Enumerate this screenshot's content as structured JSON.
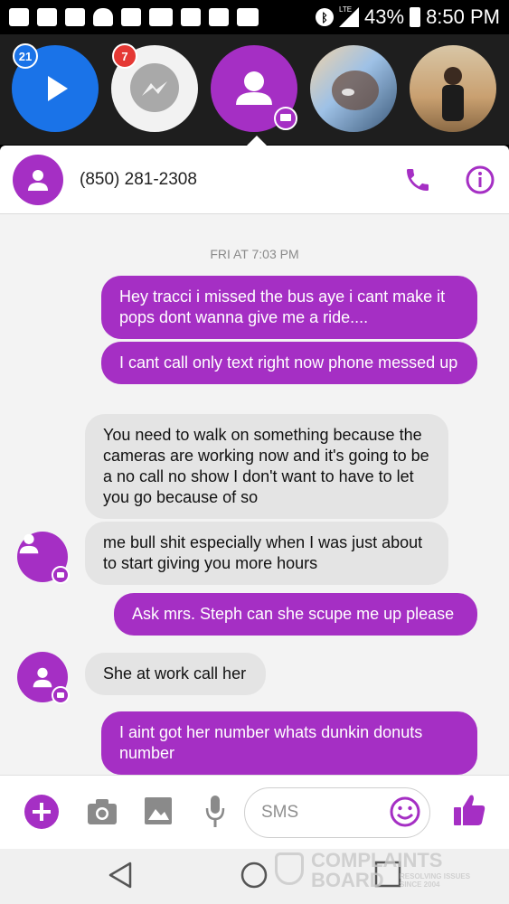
{
  "status_bar": {
    "battery": "43%",
    "time": "8:50 PM",
    "network": "LTE",
    "icons": [
      "notification-icon",
      "facebook-icon",
      "mail-icon",
      "bell-icon",
      "instagram-icon",
      "youtube-icon",
      "gallery-icon",
      "facebook-icon",
      "muted-icon",
      "bluetooth-icon",
      "signal-icon",
      "battery-icon"
    ]
  },
  "chat_heads": [
    {
      "icon": "play-icon",
      "badge": "21",
      "color": "#1a73e8",
      "badge_color": "#1a73e8"
    },
    {
      "icon": "messenger-icon",
      "badge": "7",
      "color": "#f5f5f5",
      "badge_color": "#e53935"
    },
    {
      "icon": "person-icon",
      "active": true,
      "color": "#a52fc4"
    },
    {
      "icon": "contact-photo-1"
    },
    {
      "icon": "contact-photo-2"
    }
  ],
  "contact": {
    "number": "(850) 281-2308",
    "call_icon": "phone-icon",
    "info_icon": "info-icon"
  },
  "conversation": {
    "timestamp": "FRI AT 7:03 PM",
    "messages": [
      {
        "dir": "out",
        "text": "Hey tracci i missed the bus aye i cant make it pops dont wanna give me a ride...."
      },
      {
        "dir": "out",
        "text": "I cant call only text right now phone messed up"
      },
      {
        "dir": "in",
        "text": "You need to walk on something because the cameras are working now and it's going to be a no call no show I don't want to have to let you go because of so"
      },
      {
        "dir": "in",
        "text": "me bull shit especially when I was just about to start giving you more hours"
      },
      {
        "dir": "out",
        "text": "Ask mrs. Steph can she scupe me up please"
      },
      {
        "dir": "in",
        "text": "She at work call her"
      },
      {
        "dir": "out",
        "text": "I aint got her number whats dunkin donuts number"
      }
    ]
  },
  "composer": {
    "placeholder": "SMS",
    "icons": [
      "add-icon",
      "camera-icon",
      "image-icon",
      "microphone-icon",
      "emoji-icon",
      "thumbs-up-icon"
    ]
  },
  "watermark": {
    "line1": "COMPLAINTS",
    "line2": "BOARD",
    "tagline": "RESOLVING ISSUES SINCE 2004"
  },
  "colors": {
    "accent": "#a52fc4",
    "incoming_bubble": "#e4e4e4",
    "background": "#f3f3f3"
  }
}
